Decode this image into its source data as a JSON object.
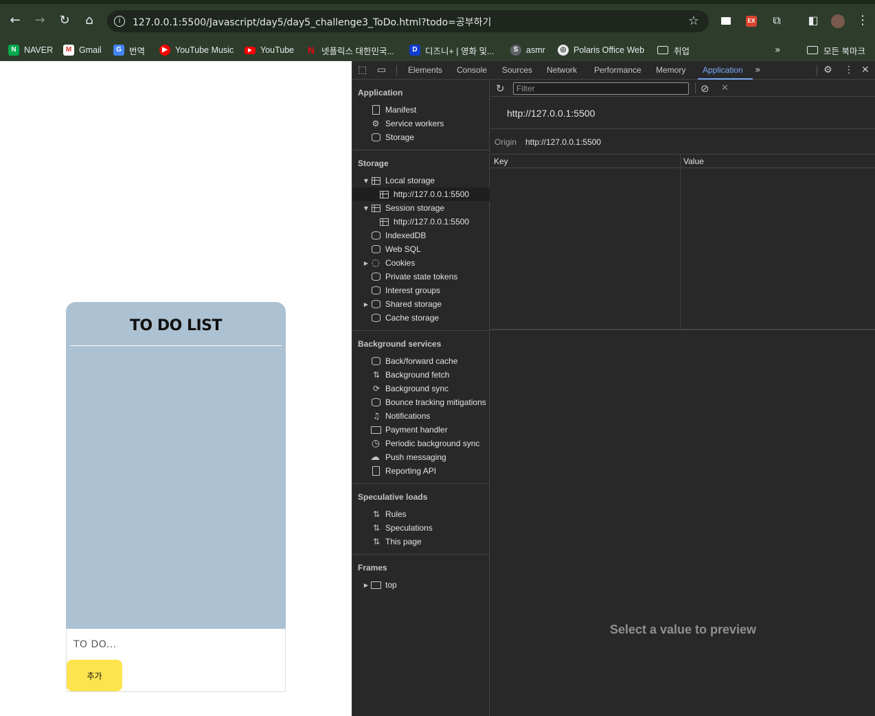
{
  "browser": {
    "url": "127.0.0.1:5500/Javascript/day5/day5_challenge3_ToDo.html?todo=공부하기",
    "bookmarks": [
      "NAVER",
      "Gmail",
      "번역",
      "YouTube Music",
      "YouTube",
      "넷플릭스 대한민국...",
      "디즈니+ | 영화 및...",
      "asmr",
      "Polaris Office Web",
      "취업"
    ],
    "all_bookmarks": "모든 북마크"
  },
  "page": {
    "title": "TO DO LIST",
    "input_placeholder": "TO DO...",
    "add_button": "추가"
  },
  "devtools": {
    "tabs": [
      "Elements",
      "Console",
      "Sources",
      "Network",
      "Performance",
      "Memory",
      "Application"
    ],
    "active_tab": "Application",
    "sidebar": {
      "application": {
        "heading": "Application",
        "items": [
          "Manifest",
          "Service workers",
          "Storage"
        ]
      },
      "storage": {
        "heading": "Storage",
        "items": [
          "Local storage",
          "http://127.0.0.1:5500",
          "Session storage",
          "http://127.0.0.1:5500",
          "IndexedDB",
          "Web SQL",
          "Cookies",
          "Private state tokens",
          "Interest groups",
          "Shared storage",
          "Cache storage"
        ]
      },
      "background": {
        "heading": "Background services",
        "items": [
          "Back/forward cache",
          "Background fetch",
          "Background sync",
          "Bounce tracking mitigations",
          "Notifications",
          "Payment handler",
          "Periodic background sync",
          "Push messaging",
          "Reporting API"
        ]
      },
      "speculative": {
        "heading": "Speculative loads",
        "items": [
          "Rules",
          "Speculations",
          "This page"
        ]
      },
      "frames": {
        "heading": "Frames",
        "items": [
          "top"
        ]
      }
    },
    "main": {
      "filter_placeholder": "Filter",
      "origin_title": "http://127.0.0.1:5500",
      "origin_label": "Origin",
      "origin_value": "http://127.0.0.1:5500",
      "col_key": "Key",
      "col_value": "Value",
      "preview": "Select a value to preview"
    }
  },
  "colors": {
    "card": "#acc1d1",
    "button": "#fde44f",
    "devtools_accent": "#7cacf8",
    "chrome_toolbar": "#2e3c2c"
  }
}
